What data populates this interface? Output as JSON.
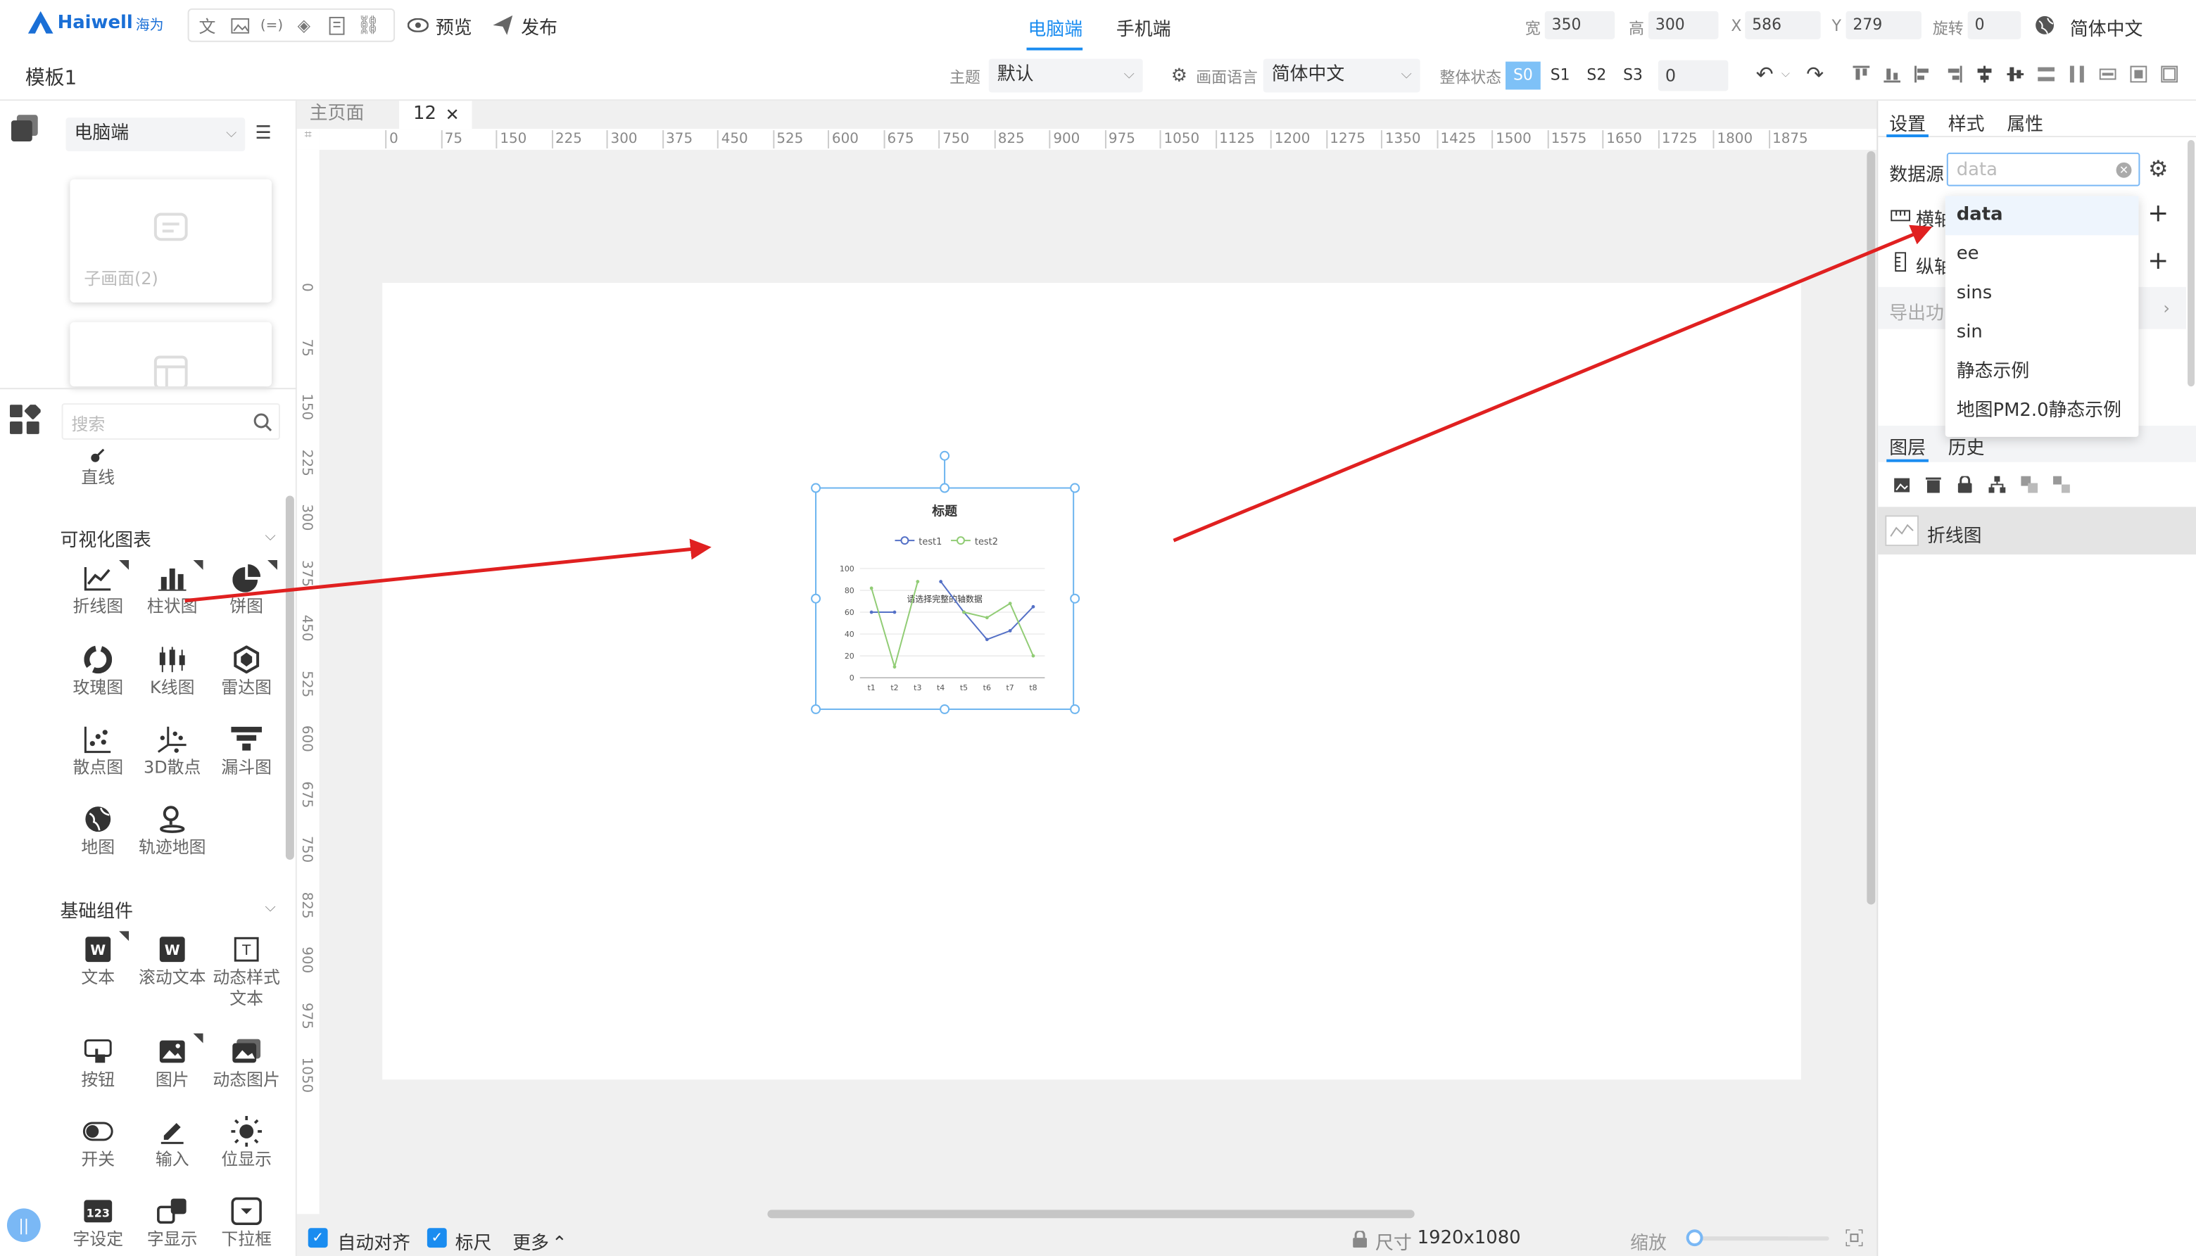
{
  "app": {
    "logo_text": "Haiwell",
    "logo_sub": "海为",
    "doc_title": "模板1"
  },
  "topbar": {
    "preview_label": "预览",
    "publish_label": "发布",
    "tabs": [
      "电脑端",
      "手机端"
    ],
    "fields": {
      "width_label": "宽",
      "width_value": "350",
      "height_label": "高",
      "height_value": "300",
      "x_label": "X",
      "x_value": "586",
      "y_label": "Y",
      "y_value": "279",
      "rotate_label": "旋转",
      "rotate_value": "0"
    },
    "language": "简体中文"
  },
  "secondbar": {
    "theme_label": "主题",
    "theme_value": "默认",
    "screen_lang_label": "画面语言",
    "screen_lang_value": "简体中文",
    "state_label": "整体状态",
    "states": [
      "S0",
      "S1",
      "S2",
      "S3"
    ],
    "state_value": "0"
  },
  "left": {
    "device_select": "电脑端",
    "subpage_label": "子画面(2)",
    "search_placeholder": "搜索",
    "line_label": "直线",
    "viz_title": "可视化图表",
    "viz_items": [
      "折线图",
      "柱状图",
      "饼图",
      "玫瑰图",
      "K线图",
      "雷达图",
      "散点图",
      "3D散点",
      "漏斗图",
      "地图",
      "轨迹地图"
    ],
    "basic_title": "基础组件",
    "basic_items": [
      "文本",
      "滚动文本",
      "动态样式文本",
      "按钮",
      "图片",
      "动态图片",
      "开关",
      "输入",
      "位显示",
      "字设定",
      "字显示",
      "下拉框"
    ]
  },
  "canvas": {
    "page_tabs": [
      "主页面",
      "12"
    ],
    "ruler_h": [
      "0",
      "75",
      "150",
      "225",
      "300",
      "375",
      "450",
      "525",
      "600",
      "675",
      "750",
      "825",
      "900",
      "975",
      "1050",
      "1125",
      "1200",
      "1275",
      "1350",
      "1425",
      "1500",
      "1575",
      "1650",
      "1725",
      "1800",
      "1875"
    ],
    "ruler_v": [
      "0",
      "75",
      "150",
      "225",
      "300",
      "375",
      "450",
      "525",
      "600",
      "675",
      "750",
      "825",
      "900",
      "975",
      "1050"
    ],
    "chart_hint": "请选择完整的轴数据"
  },
  "chart_data": {
    "type": "line",
    "title": "标题",
    "categories": [
      "t1",
      "t2",
      "t3",
      "t4",
      "t5",
      "t6",
      "t7",
      "t8"
    ],
    "series": [
      {
        "name": "test1",
        "values": [
          60,
          60,
          null,
          88,
          60,
          35,
          43,
          65
        ]
      },
      {
        "name": "test2",
        "values": [
          82,
          10,
          88,
          null,
          60,
          55,
          68,
          20
        ]
      }
    ],
    "ylim": [
      0,
      100
    ],
    "yticks": [
      "0",
      "20",
      "40",
      "60",
      "80",
      "100"
    ],
    "colors": [
      "#5470c6",
      "#91cc75"
    ]
  },
  "bottombar": {
    "auto_align": "自动对齐",
    "ruler": "标尺",
    "more": "更多",
    "size_label": "尺寸",
    "size_value": "1920x1080",
    "zoom_label": "缩放"
  },
  "right": {
    "tabs": [
      "设置",
      "样式",
      "属性"
    ],
    "datasource_label": "数据源",
    "datasource_value": "data",
    "x_axis_label": "横轴",
    "y_axis_label": "纵轴",
    "export_label": "导出功",
    "dropdown": [
      "data",
      "ee",
      "sins",
      "sin",
      "静态示例",
      "地图PM2.0静态示例"
    ],
    "layer_tabs": [
      "图层",
      "历史"
    ],
    "layer_item": "折线图"
  },
  "colors": {
    "accent": "#1a8cf0",
    "arrow": "#e02020",
    "selected_state": "#7ec1f7"
  }
}
